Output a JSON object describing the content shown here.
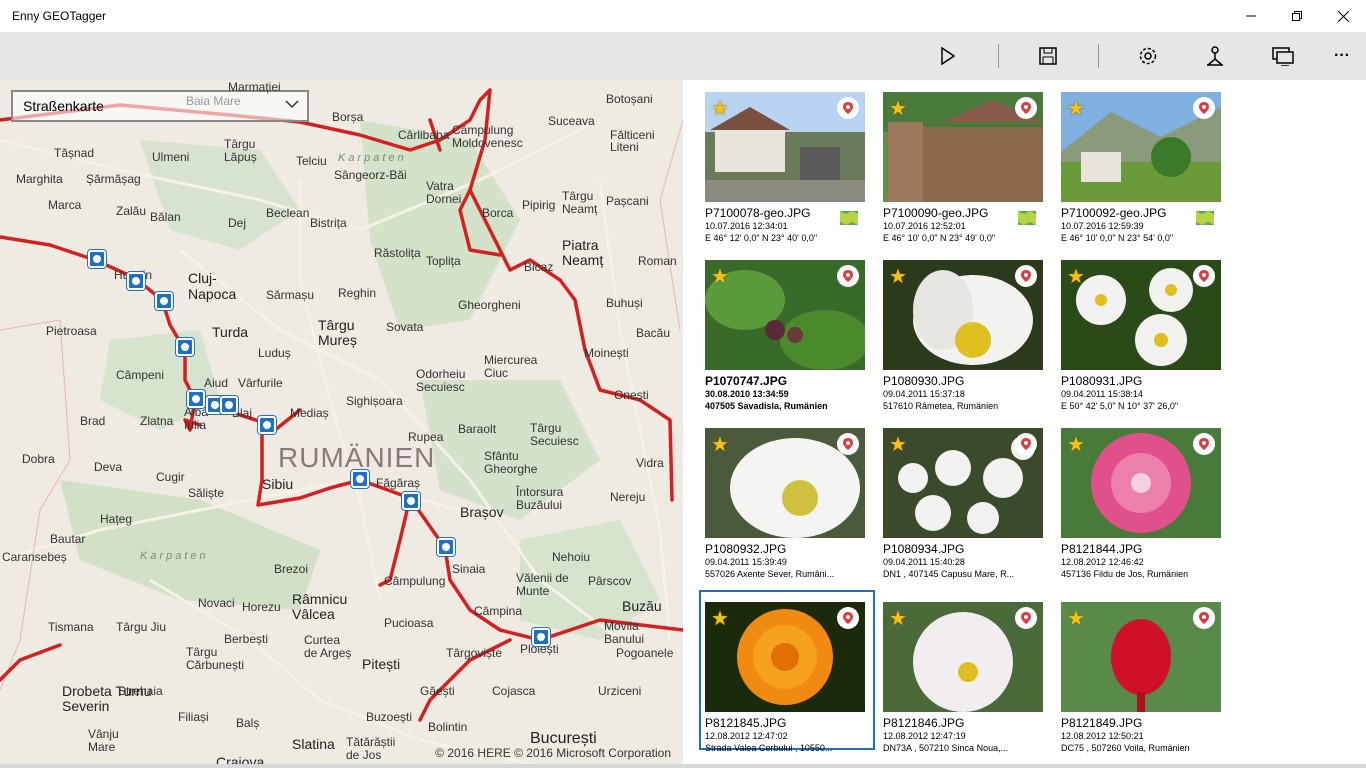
{
  "app": {
    "title": "Enny GEOTagger"
  },
  "window": {
    "minimize_icon": "minimize-icon",
    "restore_icon": "restore-icon",
    "close_icon": "close-icon"
  },
  "toolbar": {
    "items": [
      {
        "icon": "play-icon"
      },
      {
        "icon": "save-icon"
      },
      {
        "icon": "settings-icon"
      },
      {
        "icon": "person-pin-icon"
      },
      {
        "icon": "slideshow-icon"
      },
      {
        "icon": "more-icon",
        "label": "···"
      }
    ]
  },
  "map": {
    "style_select": {
      "value": "Straßenkarte"
    },
    "country_label": "RUMÄNIEN",
    "region_label_1": "Karpaten",
    "region_label_2": "Karpaten",
    "copyright": "© 2016 HERE  © 2016 Microsoft Corporation",
    "labels": [
      "Botoșani",
      "Suceava",
      "Fălticeni",
      "Baia Mare",
      "Marmației",
      "Borșa",
      "Cârlibaba",
      "Câmpulung Moldovenesc",
      "Târgu Lăpuș",
      "Ulmeni",
      "Tășnad",
      "Șărmășag",
      "Marghita",
      "Marca",
      "Zalău",
      "Bălan",
      "Telciu",
      "Sângeorz-Băi",
      "Vatra Dornei",
      "Liteni",
      "Pașcani",
      "Târgu Neamț",
      "Pipirig",
      "Borca",
      "Beclean",
      "Bistrița",
      "Dej",
      "Piatra Neamț",
      "Roman",
      "Răstolița",
      "Toplița",
      "Bicaz",
      "Cluj-Napoca",
      "Huedin",
      "Sărmașu",
      "Reghin",
      "Gheorgheni",
      "Buhuși",
      "Bacău",
      "Pietroasa",
      "Turda",
      "Luduș",
      "Târgu Mureș",
      "Sovata",
      "Moinești",
      "Câmpeni",
      "Miercurea Ciuc",
      "Odorheiu Secuiesc",
      "Onești",
      "Aiud",
      "Vârfurile",
      "Sighișoara",
      "Alba Iulia",
      "Blaj",
      "Mediaș",
      "Brad",
      "Zlatna",
      "Baraolt",
      "Târgu Secuiesc",
      "Rupea",
      "Dobra",
      "Deva",
      "Sfântu Gheorghe",
      "Vidra",
      "Cugir",
      "Săliște",
      "Sibiu",
      "Făgăraș",
      "Brașov",
      "Întorsura Buzăului",
      "Nereju",
      "Hațeg",
      "Bautar",
      "Caransebeș",
      "Brezoi",
      "Sinaia",
      "Nehoiu",
      "Câmpulung",
      "Vălenii de Munte",
      "Pârscov",
      "Novaci",
      "Horezu",
      "Râmnicu Vâlcea",
      "Câmpina",
      "Buzău",
      "Tismana",
      "Târgu Jiu",
      "Berbești",
      "Curtea de Argeș",
      "Pucioasa",
      "Movila Banului",
      "Târgu Cărbunești",
      "Târgoviște",
      "Ploiești",
      "Pogoanele",
      "Drobeta Turnu Severin",
      "Strehaia",
      "Filiași",
      "Pitești",
      "Găești",
      "Cojasca",
      "Urziceni",
      "Vânju Mare",
      "Balș",
      "Slatina",
      "Buzoești",
      "Bolintin",
      "Tătărăștii de Jos",
      "București",
      "Craiova"
    ]
  },
  "photos": [
    {
      "filename": "P7100078-geo.JPG",
      "date": "10.07.2016 12:34:01",
      "location": "E 46° 12' 0,0\" N 23° 40' 0,0\"",
      "bold": false,
      "map_icon": true
    },
    {
      "filename": "P7100090-geo.JPG",
      "date": "10.07.2016 12:52:01",
      "location": "E 46° 10' 0,0\" N 23° 49' 0,0\"",
      "bold": false,
      "map_icon": true
    },
    {
      "filename": "P7100092-geo.JPG",
      "date": "10.07.2016 12:59:39",
      "location": "E 46° 10' 0,0\" N 23° 54' 0,0\"",
      "bold": false,
      "map_icon": true
    },
    {
      "filename": "P1070747.JPG",
      "date": "30.08.2010 13:34:59",
      "location": "407505 Savadisla, Rumänien",
      "bold": true,
      "map_icon": false
    },
    {
      "filename": "P1080930.JPG",
      "date": "09.04.2011 15:37:18",
      "location": "517610 Râmetea, Rumänien",
      "bold": false,
      "map_icon": false
    },
    {
      "filename": "P1080931.JPG",
      "date": "09.04.2011 15:38:14",
      "location": "E 50° 42' 5,0\" N 10° 37' 26,0\"",
      "bold": false,
      "map_icon": false
    },
    {
      "filename": "P1080932.JPG",
      "date": "09.04.2011 15:39:49",
      "location": "557026 Axente Sever, Rumâni...",
      "bold": false,
      "map_icon": false
    },
    {
      "filename": "P1080934.JPG",
      "date": "09.04.2011 15:40:28",
      "location": "DN1 , 407145 Capusu Mare, R...",
      "bold": false,
      "map_icon": false
    },
    {
      "filename": "P8121844.JPG",
      "date": "12.08.2012 12:46:42",
      "location": "457136 Fildu de Jos, Rumänien",
      "bold": false,
      "map_icon": false
    },
    {
      "filename": "P8121845.JPG",
      "date": "12.08.2012 12:47:02",
      "location": "Strada Valea Cerbului , 10550...",
      "bold": false,
      "map_icon": false,
      "selected": true
    },
    {
      "filename": "P8121846.JPG",
      "date": "12.08.2012 12:47:19",
      "location": "DN73A , 507210 Sinca Noua,...",
      "bold": false,
      "map_icon": false
    },
    {
      "filename": "P8121849.JPG",
      "date": "12.08.2012 12:50:21",
      "location": "DC75 , 507260 Voila, Rumänien",
      "bold": false,
      "map_icon": false
    }
  ],
  "colors": {
    "accent": "#1f6fc7",
    "route": "#d42020",
    "star": "#f2c21b",
    "pin_badge": "#e0393e"
  }
}
